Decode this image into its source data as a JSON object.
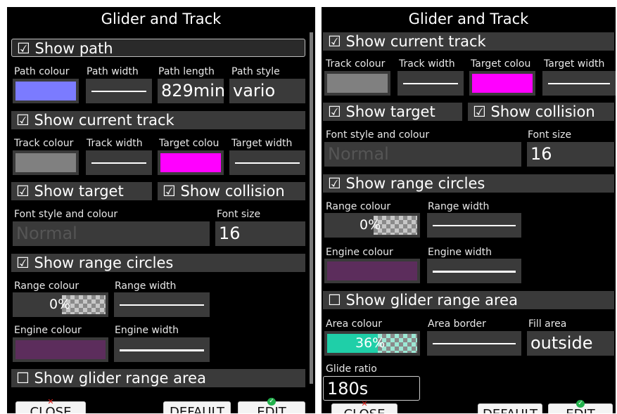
{
  "left": {
    "title": "Glider and Track",
    "show_path": "☑ Show path",
    "path_colour_label": "Path colour",
    "path_width_label": "Path width",
    "path_length_label": "Path length",
    "path_length_value": "829min",
    "path_style_label": "Path style",
    "path_style_value": "vario",
    "show_current_track": "☑ Show current track",
    "track_colour_label": "Track colour",
    "track_width_label": "Track width",
    "target_colour_label": "Target colou",
    "target_width_label": "Target width",
    "show_target": "☑ Show target",
    "show_collision": "☑ Show collision",
    "font_style_label": "Font style and colour",
    "font_style_value": "Normal",
    "font_size_label": "Font size",
    "font_size_value": "16",
    "show_range_circles": "☑ Show range circles",
    "range_colour_label": "Range colour",
    "range_colour_value": "0%",
    "range_width_label": "Range width",
    "engine_colour_label": "Engine colour",
    "engine_width_label": "Engine width",
    "show_glider_range": "☐ Show glider range area",
    "close_label": "CLOSE",
    "default_label": "DEFAULT",
    "edit_label": "EDIT"
  },
  "right": {
    "title": "Glider and Track",
    "show_current_track": "☑ Show current track",
    "track_colour_label": "Track colour",
    "track_width_label": "Track width",
    "target_colour_label": "Target colou",
    "target_width_label": "Target width",
    "show_target": "☑ Show target",
    "show_collision": "☑ Show collision",
    "font_style_label": "Font style and colour",
    "font_style_value": "Normal",
    "font_size_label": "Font size",
    "font_size_value": "16",
    "show_range_circles": "☑ Show range circles",
    "range_colour_label": "Range colour",
    "range_colour_value": "0%",
    "range_width_label": "Range width",
    "engine_colour_label": "Engine colour",
    "engine_width_label": "Engine width",
    "show_glider_range": "☐ Show glider range area",
    "area_colour_label": "Area colour",
    "area_colour_value": "36%",
    "area_border_label": "Area border",
    "fill_area_label": "Fill area",
    "fill_area_value": "outside",
    "glide_ratio_label": "Glide ratio",
    "glide_ratio_value": "180s",
    "close_label": "CLOSE",
    "default_label": "DEFAULT",
    "edit_label": "EDIT"
  },
  "colors": {
    "path": "#7b7bff",
    "track": "#808080",
    "target": "#ff00ff",
    "engine": "#5c2d5c",
    "area": "#1fcfa8"
  }
}
